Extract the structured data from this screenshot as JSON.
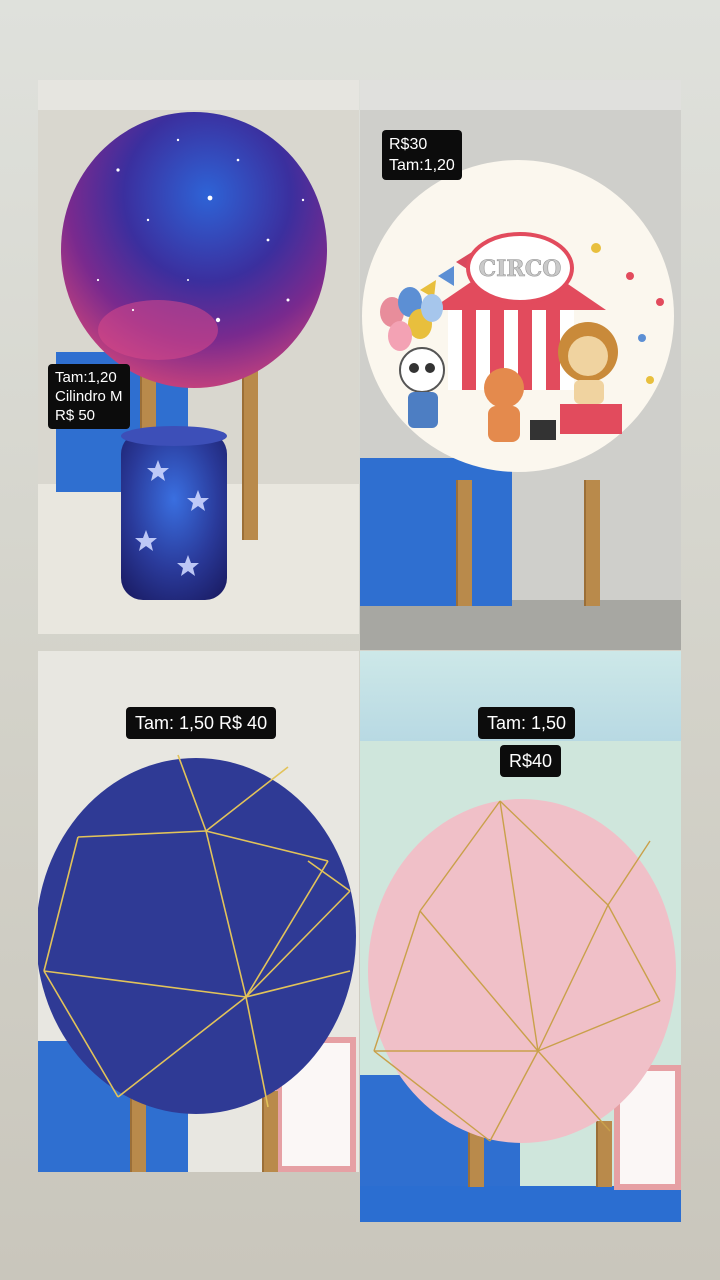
{
  "panels": {
    "galaxy": {
      "label_lines": [
        "Tam:1,20",
        "Cilindro M",
        "R$ 50"
      ]
    },
    "circus": {
      "label_lines": [
        "R$30",
        "Tam:1,20"
      ],
      "banner_text": "CIRCO"
    },
    "navy_gold": {
      "label": "Tam: 1,50 R$ 40"
    },
    "pink_gold": {
      "label_lines": [
        "Tam: 1,50",
        "R$40"
      ]
    }
  },
  "colors": {
    "galaxy": "#3a2f9a",
    "navy": "#2f3a95",
    "pink": "#f0c0c8",
    "gold": "#e2c35a",
    "wood": "#b98a4b",
    "crate_blue": "#2f6fd0"
  },
  "icons": [
    "star-icon",
    "balloon-icon",
    "lion-icon",
    "panda-icon",
    "fox-icon"
  ]
}
